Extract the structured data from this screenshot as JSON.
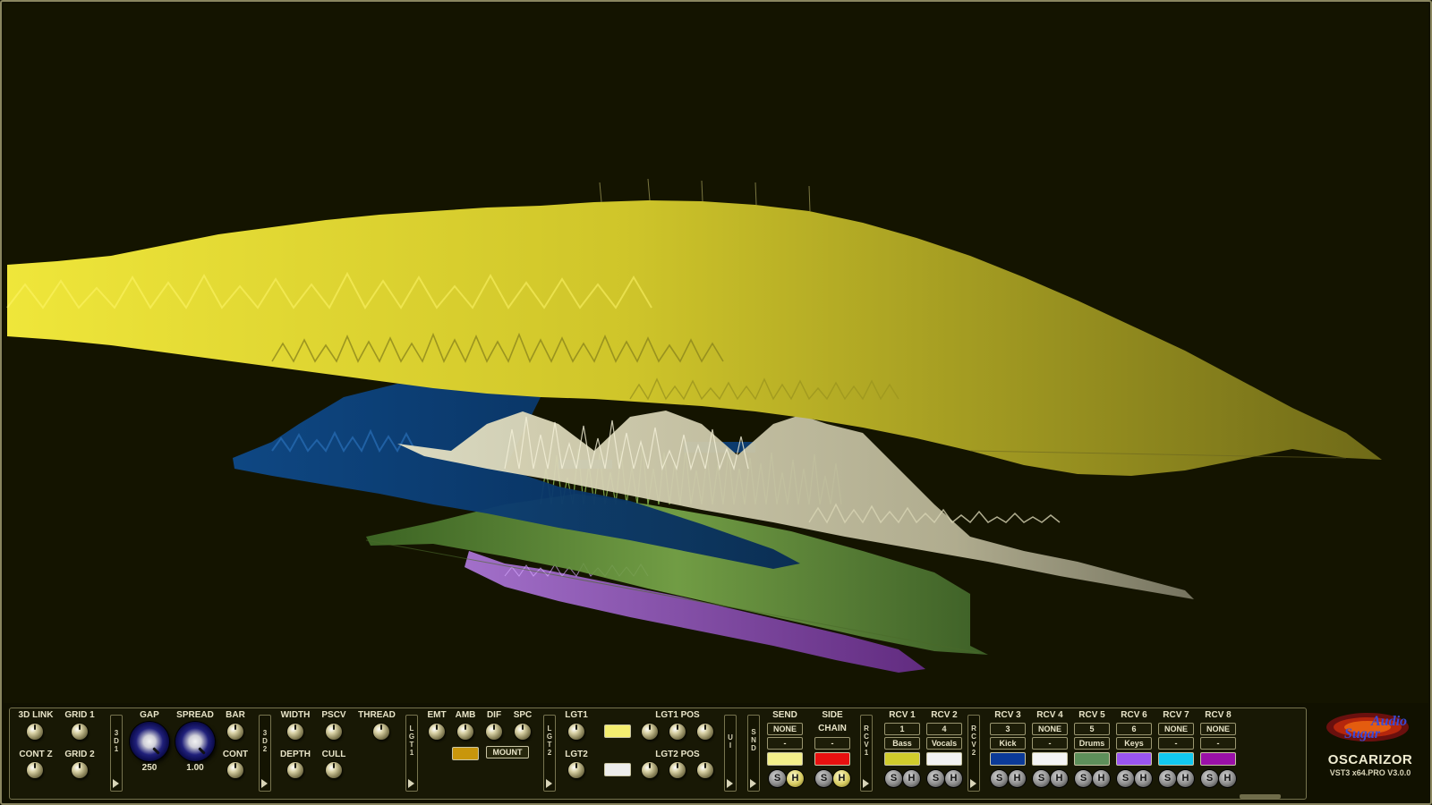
{
  "colors": {
    "yellow_layer": "#d4cf2a",
    "blue_layer": "#0b3f7a",
    "white_layer": "#d8d4b4",
    "green_layer": "#5f8f36",
    "purple_layer": "#9a55c8",
    "panel_border": "#77744f"
  },
  "panel": {
    "sec3d1": {
      "link3d": "3D LINK",
      "grid1": "GRID 1",
      "contz": "CONT Z",
      "grid2": "GRID 2",
      "gap": "GAP",
      "gap_value": "250",
      "spread": "SPREAD",
      "spread_value": "1.00",
      "bar": "BAR",
      "cont": "CONT"
    },
    "sep_3d1": "3\nD\n1",
    "sec3d2": {
      "width": "WIDTH",
      "depth": "DEPTH",
      "pscv": "PSCV",
      "cull": "CULL",
      "thread": "THREAD"
    },
    "sep_3d2": "3\nD\n2",
    "sep_lgt1": "L\nG\nT\n1",
    "material": {
      "emt": "EMT",
      "amb": "AMB",
      "dif": "DIF",
      "spc": "SPC",
      "mount": "MOUNT",
      "mount_color": "#c8960c"
    },
    "sep_lgt2": "L\nG\nT\n2",
    "lights": {
      "lgt1": "LGT1",
      "lgt2": "LGT2",
      "lgt1_pos": "LGT1 POS",
      "lgt2_pos": "LGT2 POS",
      "lgt1_color": "#f4ee70",
      "lgt2_color": "#ececec"
    },
    "sep_ui": "U\nI",
    "sep_snd": "S\nN\nD",
    "send": {
      "title": "SEND",
      "mode": "NONE",
      "name": "-",
      "color": "#f3ef8a",
      "s": "S",
      "h": "H"
    },
    "side": {
      "title1": "SIDE",
      "title2": "CHAIN",
      "name": "-",
      "color": "#e81010",
      "s": "S",
      "h": "H"
    },
    "sep_rcv1": "R\nC\nV\n1",
    "rcv_group1": [
      {
        "title": "RCV 1",
        "slot": "1",
        "name": "Bass",
        "color": "#d0cc2c",
        "s": "S",
        "h": "H"
      },
      {
        "title": "RCV 2",
        "slot": "4",
        "name": "Vocals",
        "color": "#f2f2f2",
        "s": "S",
        "h": "H"
      }
    ],
    "sep_rcv2": "R\nC\nV\n2",
    "rcv_group2": [
      {
        "title": "RCV 3",
        "slot": "3",
        "name": "Kick",
        "color": "#0b3a98",
        "s": "S",
        "h": "H"
      },
      {
        "title": "RCV 4",
        "slot": "NONE",
        "name": "-",
        "color": "#f4f4f4",
        "s": "S",
        "h": "H"
      },
      {
        "title": "RCV 5",
        "slot": "5",
        "name": "Drums",
        "color": "#5d8f5a",
        "s": "S",
        "h": "H"
      },
      {
        "title": "RCV 6",
        "slot": "6",
        "name": "Keys",
        "color": "#9a55f0",
        "s": "S",
        "h": "H"
      },
      {
        "title": "RCV 7",
        "slot": "NONE",
        "name": "-",
        "color": "#12c8f0",
        "s": "S",
        "h": "H"
      },
      {
        "title": "RCV 8",
        "slot": "NONE",
        "name": "-",
        "color": "#9a10a8",
        "s": "S",
        "h": "H"
      }
    ]
  },
  "brand": {
    "logo_line1": "Audio",
    "logo_line2": "Sugar",
    "name": "OSCARIZOR",
    "version": "VST3 x64.PRO V3.0.0"
  }
}
